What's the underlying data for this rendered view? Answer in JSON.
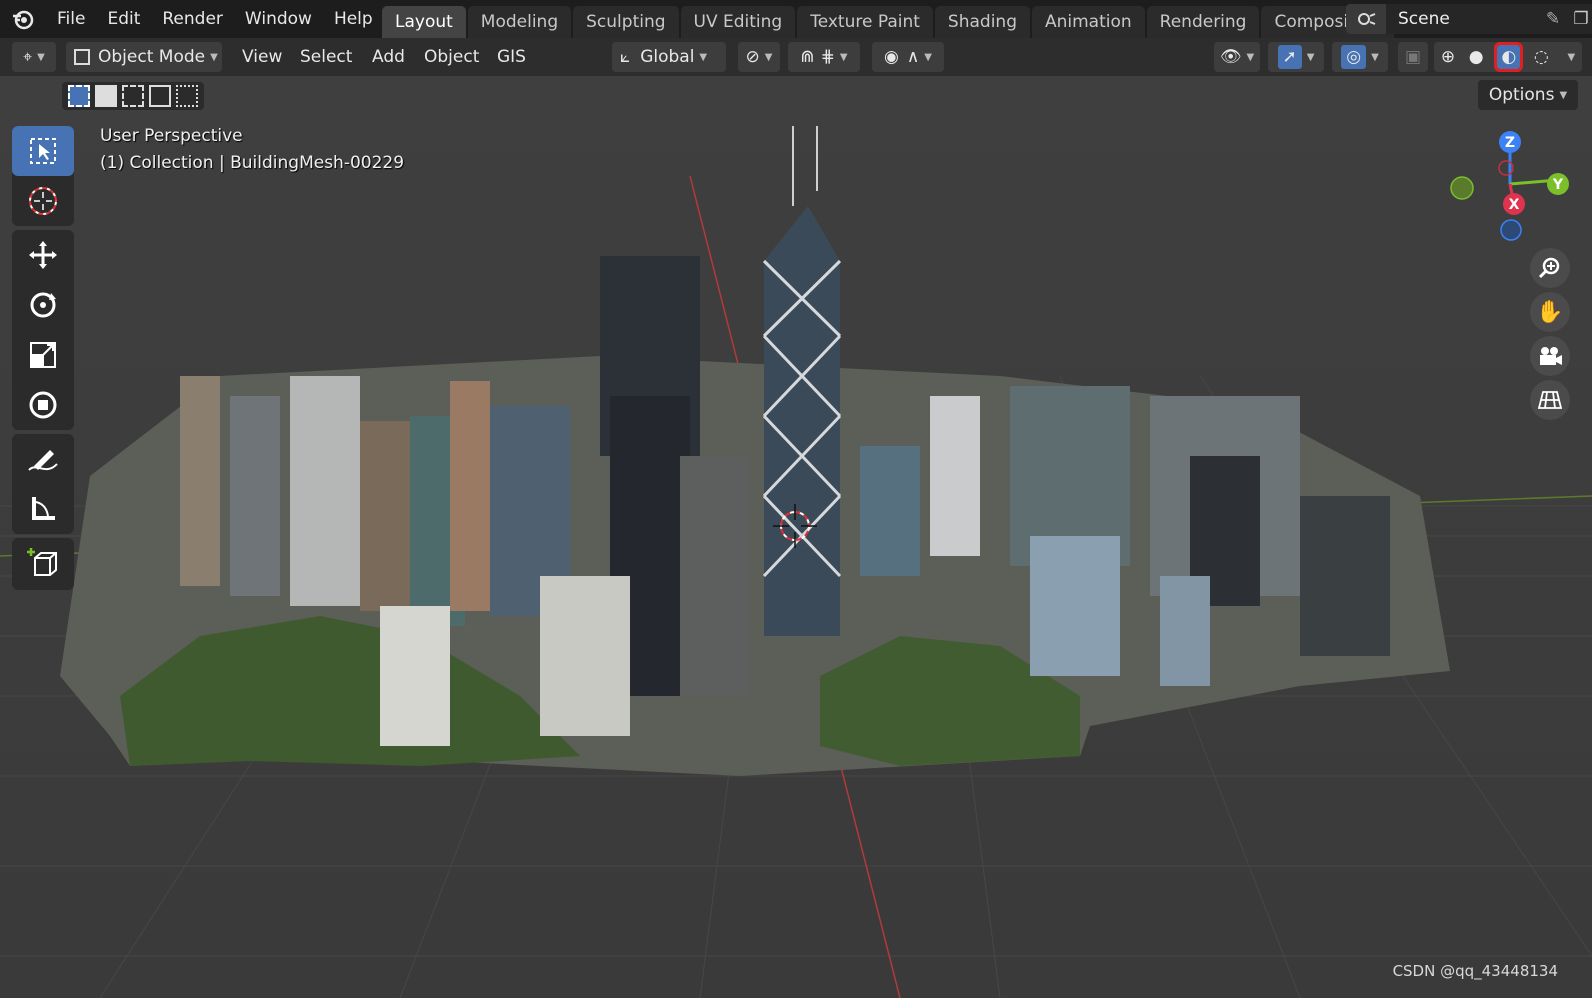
{
  "menu": [
    "File",
    "Edit",
    "Render",
    "Window",
    "Help"
  ],
  "workspace_tabs": [
    "Layout",
    "Modeling",
    "Sculpting",
    "UV Editing",
    "Texture Paint",
    "Shading",
    "Animation",
    "Rendering",
    "Compositing"
  ],
  "active_tab": "Layout",
  "scene_name": "Scene",
  "header": {
    "mode": "Object Mode",
    "view": "View",
    "select": "Select",
    "add": "Add",
    "object": "Object",
    "gis": "GIS",
    "orientation": "Global"
  },
  "options_label": "Options",
  "viewport": {
    "perspective": "User Perspective",
    "collection": "(1) Collection | BuildingMesh-00229"
  },
  "gizmo": {
    "z": "Z",
    "y": "Y",
    "x": "X"
  },
  "watermark": "CSDN @qq_43448134",
  "colors": {
    "accent": "#4772b3",
    "highlight": "#e02020",
    "x_axis": "#e0334e",
    "y_axis": "#7bbf2a",
    "z_axis": "#3b82f6"
  }
}
